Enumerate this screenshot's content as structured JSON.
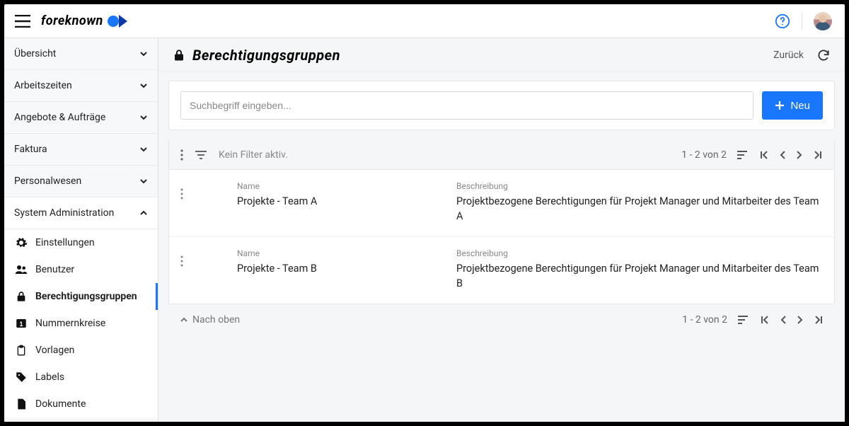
{
  "brand": {
    "name": "foreknown"
  },
  "sidebar": {
    "groups": [
      {
        "label": "Übersicht"
      },
      {
        "label": "Arbeitszeiten"
      },
      {
        "label": "Angebote & Aufträge"
      },
      {
        "label": "Faktura"
      },
      {
        "label": "Personalwesen"
      },
      {
        "label": "System Administration"
      }
    ],
    "sysadmin_items": [
      {
        "label": "Einstellungen",
        "icon": "gear"
      },
      {
        "label": "Benutzer",
        "icon": "users"
      },
      {
        "label": "Berechtigungsgruppen",
        "icon": "lock",
        "active": true
      },
      {
        "label": "Nummernkreise",
        "icon": "counter"
      },
      {
        "label": "Vorlagen",
        "icon": "clipboard"
      },
      {
        "label": "Labels",
        "icon": "tag"
      },
      {
        "label": "Dokumente",
        "icon": "document"
      }
    ]
  },
  "page": {
    "title": "Berechtigungsgruppen",
    "back_label": "Zurück"
  },
  "search": {
    "placeholder": "Suchbegriff eingeben...",
    "new_button": "Neu"
  },
  "toolbar": {
    "filter_text": "Kein Filter aktiv.",
    "page_info": "1 - 2 von 2"
  },
  "columns": {
    "name": "Name",
    "desc": "Beschreibung"
  },
  "rows": [
    {
      "name": "Projekte - Team A",
      "desc": "Projektbezogene Berechtigungen für Projekt Manager und Mitarbeiter des Team A"
    },
    {
      "name": "Projekte - Team B",
      "desc": "Projektbezogene Berechtigungen für Projekt Manager und Mitarbeiter des Team B"
    }
  ],
  "footer": {
    "to_top": "Nach oben",
    "page_info": "1 - 2 von 2"
  }
}
